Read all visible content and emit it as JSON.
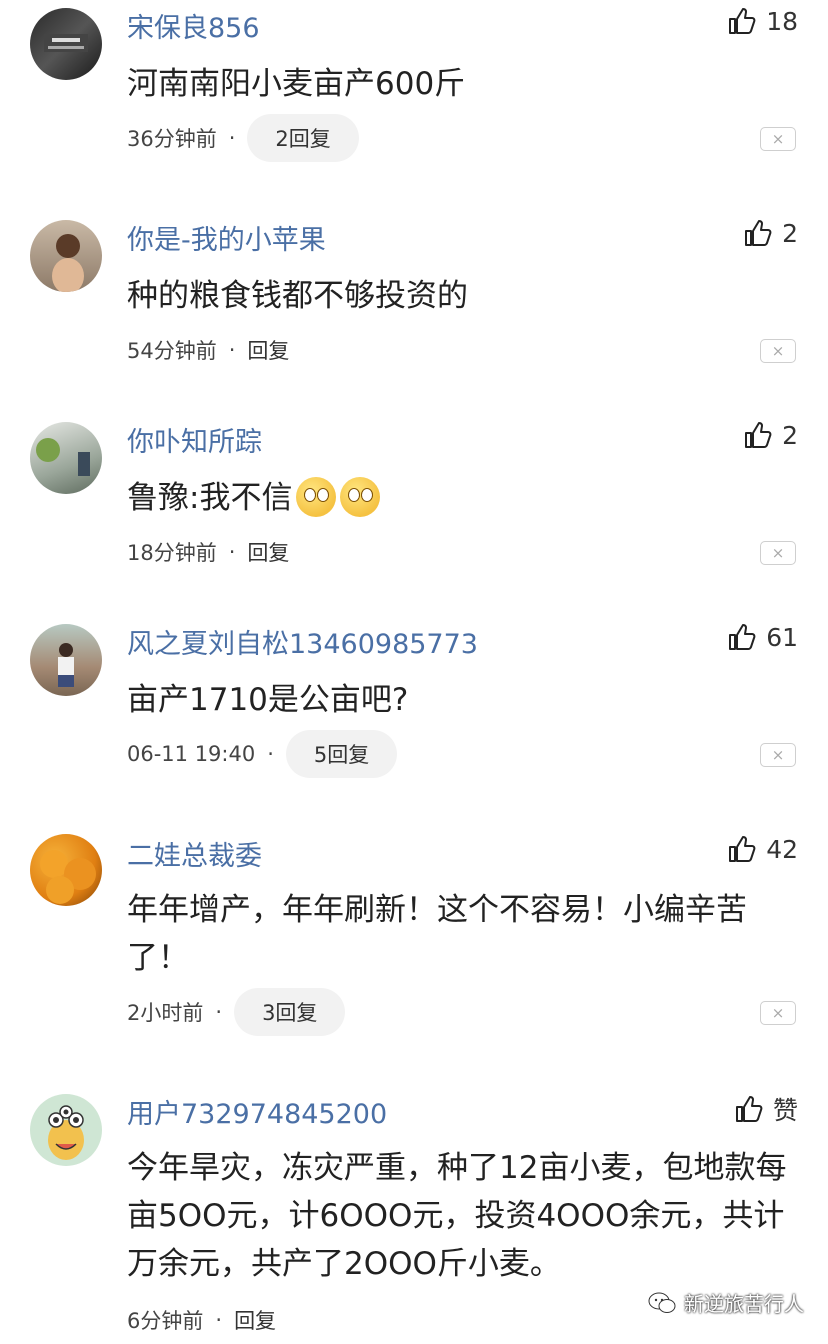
{
  "comments": [
    {
      "user": "宋保良856",
      "likes": "18",
      "text": "河南南阳小麦亩产600斤",
      "time": "36分钟前",
      "reply": "2回复"
    },
    {
      "user": "你是-我的小苹果",
      "likes": "2",
      "text": "种的粮食钱都不够投资的",
      "time": "54分钟前",
      "reply": "回复"
    },
    {
      "user": "你卟知所踪",
      "likes": "2",
      "text": "鲁豫:我不信",
      "time": "18分钟前",
      "reply": "回复"
    },
    {
      "user": "风之夏刘自松13460985773",
      "likes": "61",
      "text": "亩产1710是公亩吧?",
      "time": "06-11 19:40",
      "reply": "5回复"
    },
    {
      "user": "二娃总裁委",
      "likes": "42",
      "text": "年年增产，年年刷新！这个不容易！小编辛苦了！",
      "time": "2小时前",
      "reply": "3回复"
    },
    {
      "user": "用户732974845200",
      "likes": "赞",
      "text": "今年旱灾，冻灾严重，种了12亩小麦，包地款每亩5OO元，计6OOO元，投资4OOO余元，共计万余元，共产了2OOO斤小麦。",
      "time": "6分钟前",
      "reply": "回复"
    }
  ],
  "separator": "·",
  "close_glyph": "×",
  "watermark": "新逆旅苦行人",
  "icons": {
    "like": "thumbs-up-icon",
    "close": "close-icon",
    "watermark": "wechat-icon",
    "emoji": "thinking-face-emoji"
  }
}
